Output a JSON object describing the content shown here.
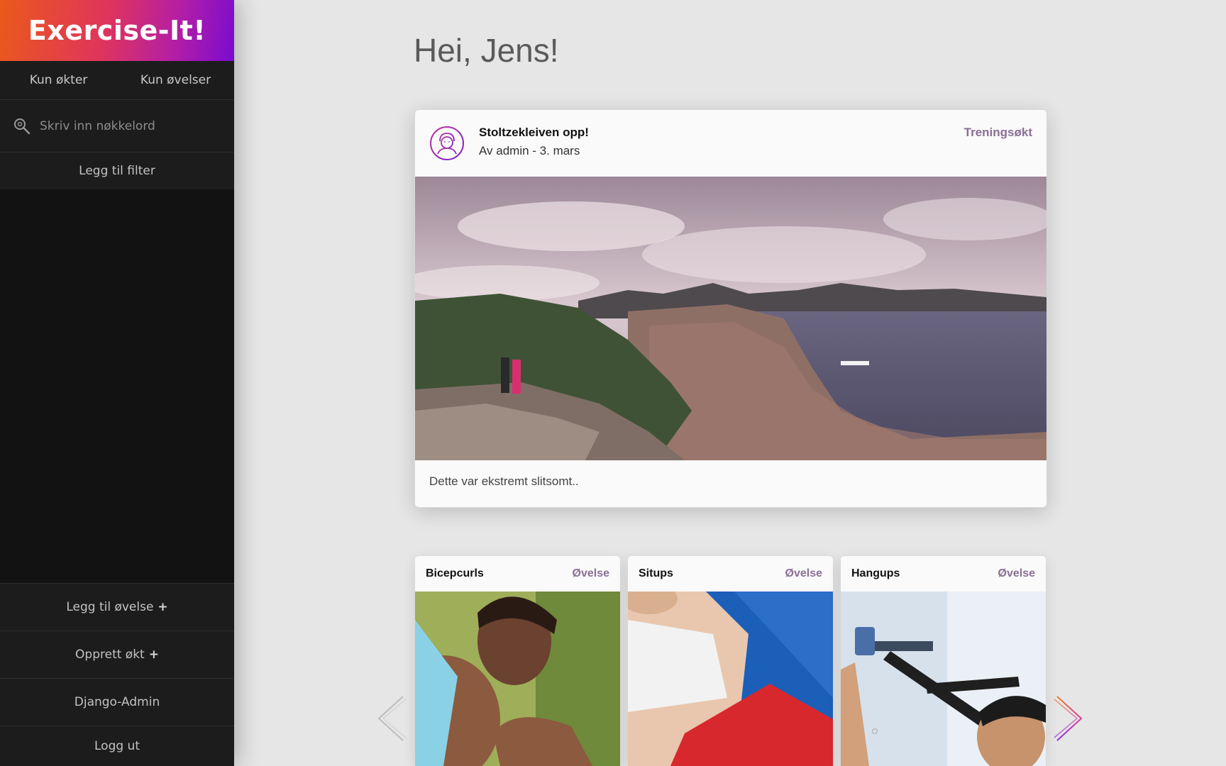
{
  "sidebar": {
    "brand": "Exercise-It!",
    "filters": {
      "sessions_only": "Kun økter",
      "exercises_only": "Kun øvelser"
    },
    "search": {
      "placeholder": "Skriv inn nøkkelord",
      "value": ""
    },
    "add_filter": "Legg til filter",
    "menu": {
      "add_exercise": "Legg til øvelse",
      "create_session": "Opprett økt",
      "admin": "Django-Admin",
      "logout": "Logg ut",
      "plus": "+"
    }
  },
  "main": {
    "greeting": "Hei, Jens!",
    "post": {
      "title": "Stoltzekleiven opp!",
      "meta": "Av admin - 3. mars",
      "type": "Treningsøkt",
      "body": "Dette var ekstremt slitsomt.."
    },
    "exercises": [
      {
        "name": "Bicepcurls",
        "type": "Øvelse"
      },
      {
        "name": "Situps",
        "type": "Øvelse"
      },
      {
        "name": "Hangups",
        "type": "Øvelse"
      }
    ]
  },
  "colors": {
    "brand_gradient": [
      "#ea5a1a",
      "#e0345c",
      "#b31ea6",
      "#7a0bd0"
    ],
    "accent": "#8a6f95",
    "sidebar_bg": "#121212"
  },
  "icons": [
    "search-icon",
    "avatar-icon",
    "chevron-left-icon",
    "chevron-right-icon"
  ]
}
